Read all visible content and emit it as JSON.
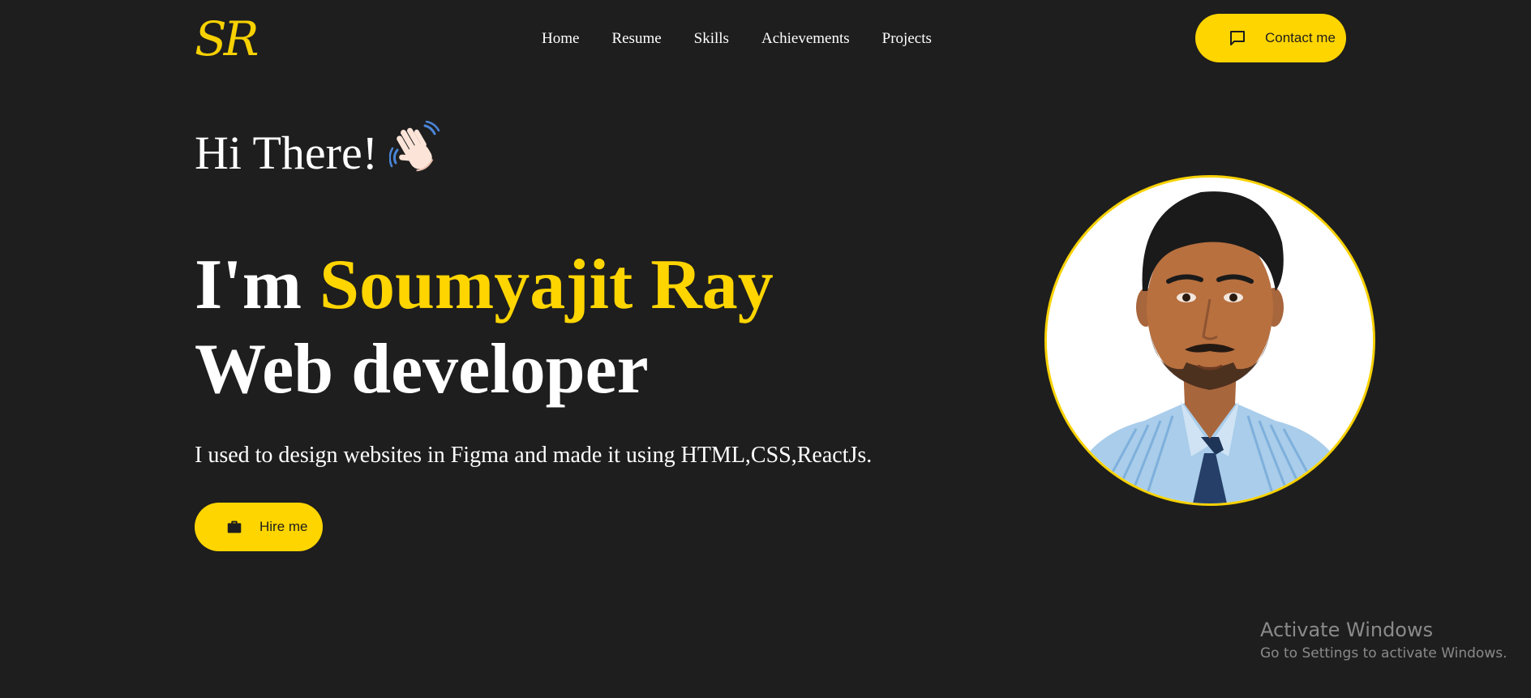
{
  "header": {
    "logo": "SR",
    "nav": [
      "Home",
      "Resume",
      "Skills",
      "Achievements",
      "Projects"
    ],
    "contact_label": "Contact me"
  },
  "hero": {
    "greeting": "Hi There!",
    "greeting_emoji": "waving-hand",
    "headline_prefix": "I'm ",
    "name": "Soumyajit Ray",
    "role": "Web developer",
    "description": "I used to design websites in Figma and made it using HTML,CSS,ReactJs.",
    "hire_label": "Hire me"
  },
  "watermark": {
    "title": "Activate Windows",
    "subtitle": "Go to Settings to activate Windows."
  },
  "colors": {
    "background": "#1e1e1e",
    "accent": "#ffd500",
    "text": "#ffffff"
  },
  "icons": {
    "contact": "chat-bubble-icon",
    "hire": "briefcase-icon"
  }
}
